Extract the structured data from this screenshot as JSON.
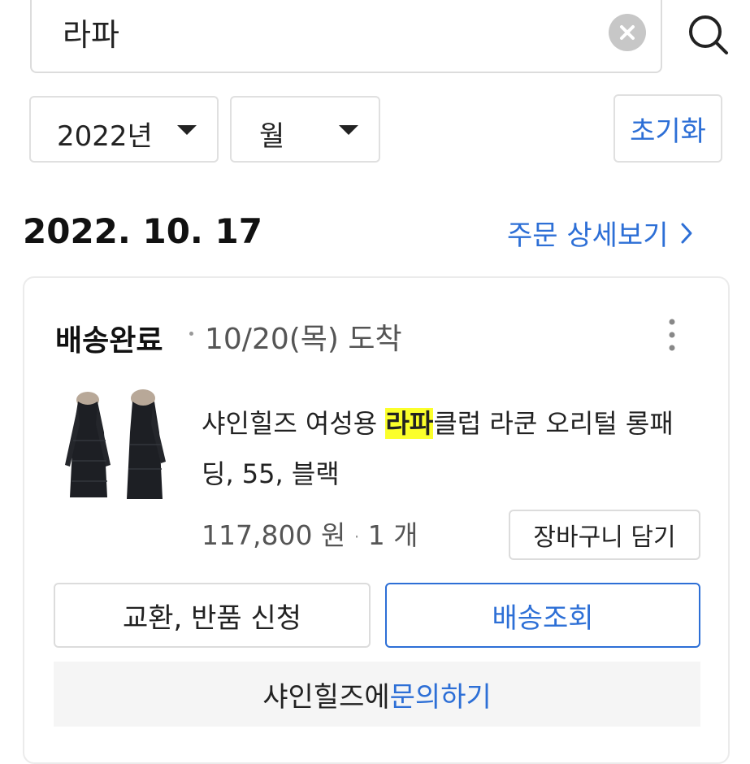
{
  "search": {
    "query": "라파",
    "clear_icon": "clear-icon",
    "search_icon": "search-icon"
  },
  "filters": {
    "year": "2022년",
    "month": "월",
    "reset_label": "초기화"
  },
  "order": {
    "date": "2022. 10. 17",
    "detail_link": "주문 상세보기",
    "status": "배송완료",
    "arrival": "10/20(목) 도착",
    "product": {
      "title_before": "샤인힐즈 여성용 ",
      "title_highlight": "라파",
      "title_after": "클럽 라쿤 오리털 롱패딩, 55, 블랙",
      "price": "117,800 원",
      "quantity": "1 개"
    },
    "cart_button": "장바구니 담기",
    "return_button": "교환, 반품 신청",
    "tracking_button": "배송조회",
    "inquiry_prefix": "샤인힐즈에 ",
    "inquiry_link": "문의하기"
  },
  "colors": {
    "accent": "#2d6fd6",
    "highlight": "#fbff2b"
  }
}
